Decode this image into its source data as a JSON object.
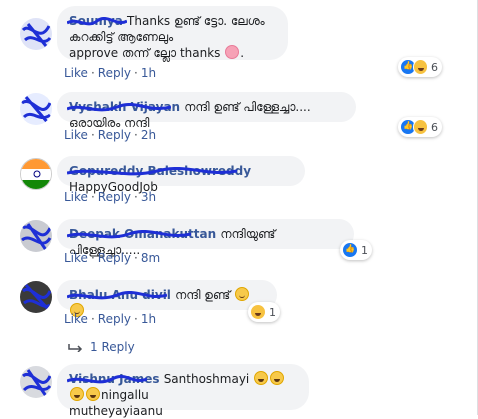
{
  "comments": [
    {
      "name": "Soumya",
      "text_main": "Thanks ഉണ്ട് ട്ടോ. ലേശം കറക്കിട്ട് ആണേലും",
      "text_line2_a": "approve തന്ന് ല്ലോ thanks",
      "emoji_trailing": "wink-emoji",
      "like": "Like",
      "reply": "Reply",
      "time": "1h",
      "reaction_count": "6"
    },
    {
      "name": "Vyshakh Vijayan",
      "text": "നന്ദി ഉണ്ട് പിള്ളേച്ചാ.... ഒരായിരം നന്ദി",
      "like": "Like",
      "reply": "Reply",
      "time": "2h",
      "reaction_count": "6"
    },
    {
      "name": "Gopureddy Baleshowreddy",
      "text": "HappyGoodJob",
      "like": "Like",
      "reply": "Reply",
      "time": "3h"
    },
    {
      "name": "Deepak Omanakuttan",
      "text": "നന്ദിയുണ്ട് പിള്ളേച്ചാ.....",
      "like": "Like",
      "reply": "Reply",
      "time": "8m",
      "reaction_count": "1"
    },
    {
      "name": "Bhalu Anu divil",
      "text": "നന്ദി ഉണ്ട്",
      "like": "Like",
      "reply": "Reply",
      "time": "1h",
      "reaction_count": "1"
    }
  ],
  "replies_link": "1 Reply",
  "reply_comment": {
    "name": "Vishnu James",
    "text_a": "Santhoshmayi",
    "text_b": "ningallu",
    "text_line2": "mutheyayiaanu"
  },
  "colors": {
    "link": "#385898",
    "bubble": "#f2f3f5",
    "scribble": "#1e2fd6"
  }
}
